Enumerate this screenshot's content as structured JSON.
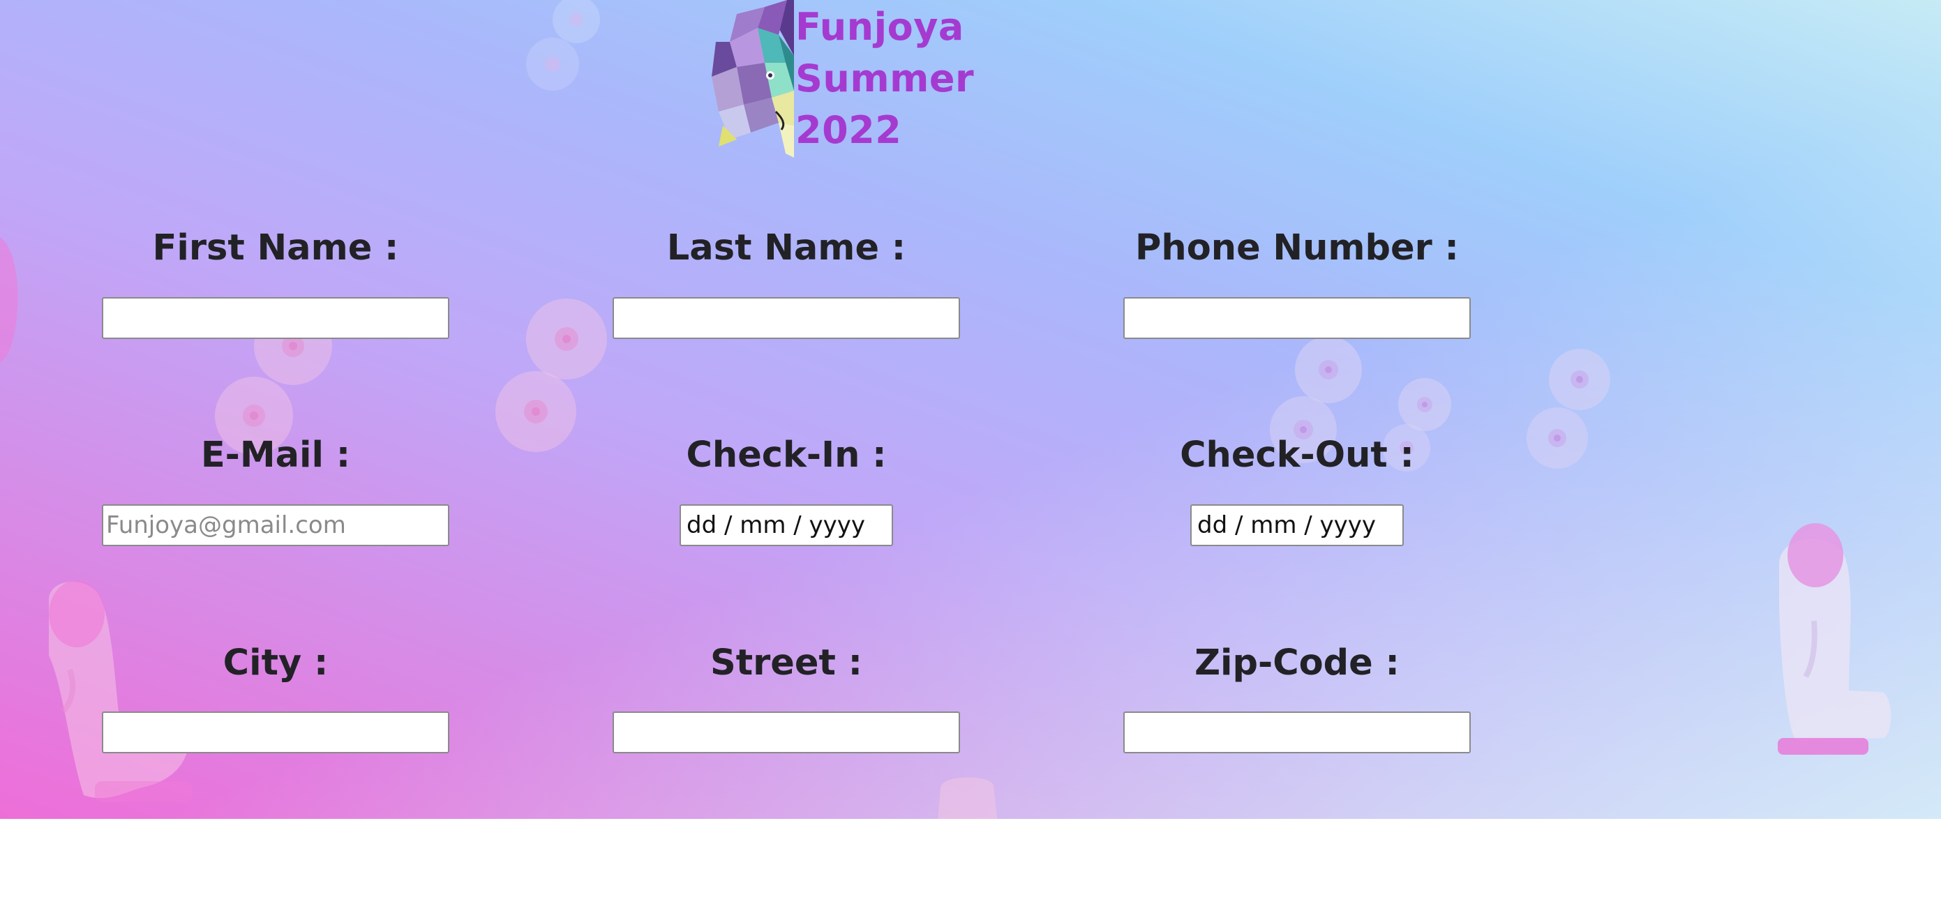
{
  "brand": {
    "title_lines": [
      "Funjoya",
      "Summer",
      "2022"
    ],
    "logo": "lion-head-polygon-icon",
    "color": "#a53ad0"
  },
  "form": {
    "first_name": {
      "label": "First Name :",
      "value": ""
    },
    "last_name": {
      "label": "Last Name :",
      "value": ""
    },
    "phone": {
      "label": "Phone Number :",
      "value": ""
    },
    "email": {
      "label": "E-Mail :",
      "placeholder": "Funjoya@gmail.com",
      "value": ""
    },
    "check_in": {
      "label": "Check-In :",
      "display": "dd / mm / yyyy"
    },
    "check_out": {
      "label": "Check-Out :",
      "display": "dd / mm / yyyy"
    },
    "city": {
      "label": "City :",
      "value": ""
    },
    "street": {
      "label": "Street :",
      "value": ""
    },
    "zip": {
      "label": "Zip-Code :",
      "value": ""
    }
  },
  "decorations": [
    "disc-cluster-icon",
    "bottle-icon",
    "cone-icon"
  ],
  "colors": {
    "label": "#222226",
    "gradient_pink": "#ee6ed8",
    "gradient_lavender": "#bfa8f8",
    "gradient_sky": "#9fcffb"
  }
}
